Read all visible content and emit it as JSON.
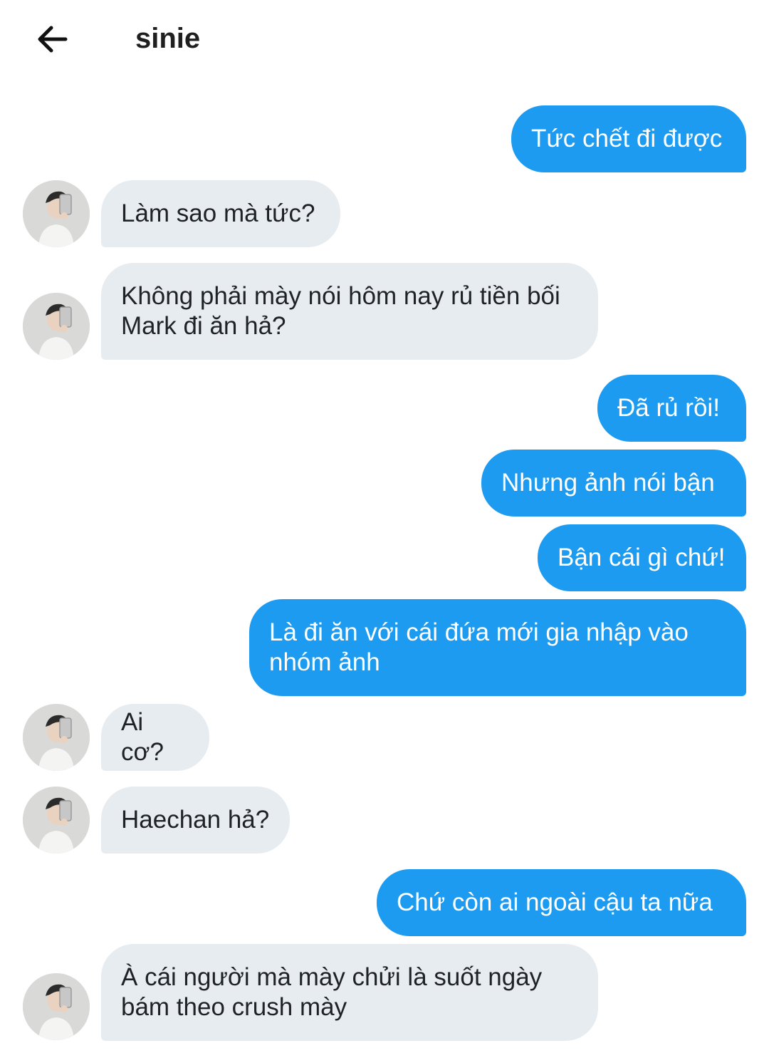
{
  "header": {
    "title": "sinie",
    "back_icon": "arrow-left-icon"
  },
  "colors": {
    "outgoing_bubble": "#1d9bf0",
    "incoming_bubble": "#e7ecf0",
    "outgoing_text": "#ffffff",
    "incoming_text": "#1f2326"
  },
  "messages": [
    {
      "sender": "me",
      "text": "Tức chết đi được"
    },
    {
      "sender": "sinie",
      "text": "Làm sao mà tức?"
    },
    {
      "sender": "sinie",
      "text": "Không phải mày nói hôm nay rủ tiền bối\nMark đi ăn hả?"
    },
    {
      "sender": "me",
      "text": "Đã rủ rồi!"
    },
    {
      "sender": "me",
      "text": "Nhưng ảnh nói bận"
    },
    {
      "sender": "me",
      "text": "Bận cái gì chứ!"
    },
    {
      "sender": "me",
      "text": "Là đi ăn với cái đứa mới gia nhập vào\nnhóm ảnh"
    },
    {
      "sender": "sinie",
      "text": "Ai cơ?"
    },
    {
      "sender": "sinie",
      "text": "Haechan hả?"
    },
    {
      "sender": "me",
      "text": "Chứ còn ai ngoài cậu ta nữa"
    },
    {
      "sender": "sinie",
      "text": "À cái người mà mày chửi là suốt ngày\nbám theo crush mày"
    }
  ]
}
